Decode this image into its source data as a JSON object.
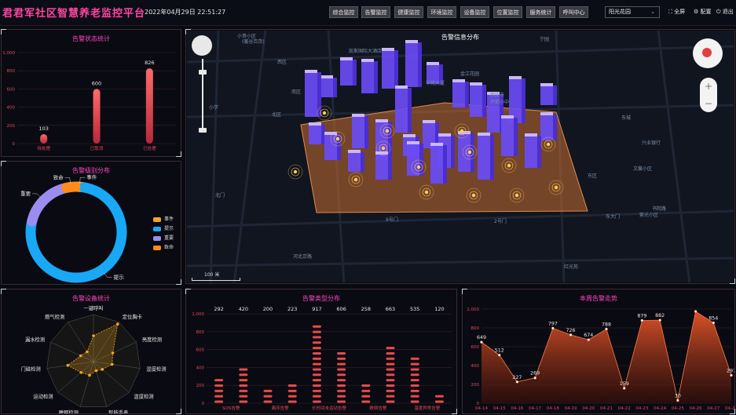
{
  "header": {
    "title": "君君军社区智慧养老监控平台",
    "datetime": "2022年04月29日 22:51:27",
    "tabs": [
      {
        "label": "综合监控",
        "active": false
      },
      {
        "label": "告警监控",
        "active": true
      },
      {
        "label": "健康监控",
        "active": false
      },
      {
        "label": "环境监控",
        "active": false
      },
      {
        "label": "设备监控",
        "active": false
      },
      {
        "label": "位置监控",
        "active": false
      },
      {
        "label": "服务统计",
        "active": false
      },
      {
        "label": "呼叫中心",
        "active": false
      }
    ],
    "community_select": "阳光花园",
    "fullscreen_label": "全屏",
    "config_label": "配置",
    "exit_label": "退出"
  },
  "colors": {
    "accent": "#ff45c0",
    "active_tab": "#d8384e",
    "bar_red": "#e84a4a",
    "area_orange": "#e8562a"
  },
  "map": {
    "title": "告警信息分布",
    "scale_label": "100 米",
    "labels": [
      "小哥小区",
      "(暖谷百货)",
      "凯斯国际大酒店",
      "西区",
      "南区",
      "北区",
      "小学",
      "华苑大厦",
      "金江花园",
      "宁园",
      "西安市",
      "开箭小中",
      "东城",
      "兴业银行",
      "文馨小区",
      "东区",
      "9号门",
      "2号门",
      "东大门",
      "书院路",
      "紫光小区",
      "红光苑",
      "河北京路",
      "北门"
    ]
  },
  "chart_data": [
    {
      "type": "bar",
      "title": "告警状态统计",
      "categories": [
        "待处理",
        "已取消",
        "已处理"
      ],
      "values": [
        103,
        600,
        826
      ],
      "ylim": [
        0,
        1000
      ],
      "yticks": [
        "0",
        "200",
        "400",
        "600",
        "800",
        "1,000"
      ],
      "color": "#e84a4a"
    },
    {
      "type": "pie",
      "title": "告警级别分布",
      "slices": [
        {
          "label": "事件",
          "value": 22,
          "color": "#f5a623"
        },
        {
          "label": "提示",
          "value": 708,
          "color": "#18a8f5"
        },
        {
          "label": "重要",
          "value": 165,
          "color": "#9b8cf0"
        },
        {
          "label": "致命",
          "value": 35,
          "color": "#ff8c1a"
        }
      ],
      "legend": [
        "事件",
        "提示",
        "重要",
        "致命"
      ],
      "legend_position": "right"
    },
    {
      "type": "radar",
      "title": "告警设备统计",
      "axes": [
        "一键呼叫",
        "定位胸卡",
        "亮度检测",
        "湿度检测",
        "温度检测",
        "智能手表",
        "睡眠检测",
        "运动检测",
        "门磁检测",
        "漏水检测",
        "燃气检测"
      ],
      "values": [
        55,
        95,
        45,
        40,
        25,
        20,
        30,
        35,
        55,
        30,
        25
      ],
      "max": 100,
      "color": "#f5a623"
    },
    {
      "type": "bar",
      "title": "告警类型分布",
      "categories": [
        "SOS告警",
        "离床告警",
        "长时间未运动告警",
        "跌倒告警",
        "温度异常告警",
        "湿度异常告警",
        "燃气告警",
        "烟感告警",
        "漏水告警",
        "门磁告警"
      ],
      "tick_labels": [
        "SOS告警",
        "",
        "离床告警",
        "",
        "长时间未运动告警",
        "",
        "跌倒告警",
        "",
        "温度异常告警",
        ""
      ],
      "values": [
        292,
        420,
        200,
        223,
        917,
        606,
        258,
        663,
        535,
        120
      ],
      "ylim": [
        0,
        1000
      ],
      "yticks": [
        "0",
        "200",
        "400",
        "600",
        "800",
        "1,000"
      ],
      "color": "#e84a4a"
    },
    {
      "type": "area",
      "title": "本周告警走势",
      "categories": [
        "04-14",
        "04-15",
        "04-16",
        "04-17",
        "04-18",
        "04-19",
        "04-20",
        "04-21",
        "04-22",
        "04-23",
        "04-24",
        "04-25",
        "04-26",
        "04-27",
        "04-28"
      ],
      "values": [
        649,
        512,
        227,
        269,
        797,
        726,
        674,
        788,
        159,
        879,
        882,
        30,
        975,
        854,
        297
      ],
      "labels": [
        "649",
        "512",
        "227",
        "269",
        "797",
        "726",
        "674",
        "788",
        "159",
        "879",
        "882",
        "30",
        "",
        "854",
        "297"
      ],
      "ylim": [
        0,
        1000
      ],
      "yticks": [
        "0",
        "200",
        "400",
        "600",
        "800",
        "1,000"
      ],
      "color": "#e8562a"
    }
  ]
}
